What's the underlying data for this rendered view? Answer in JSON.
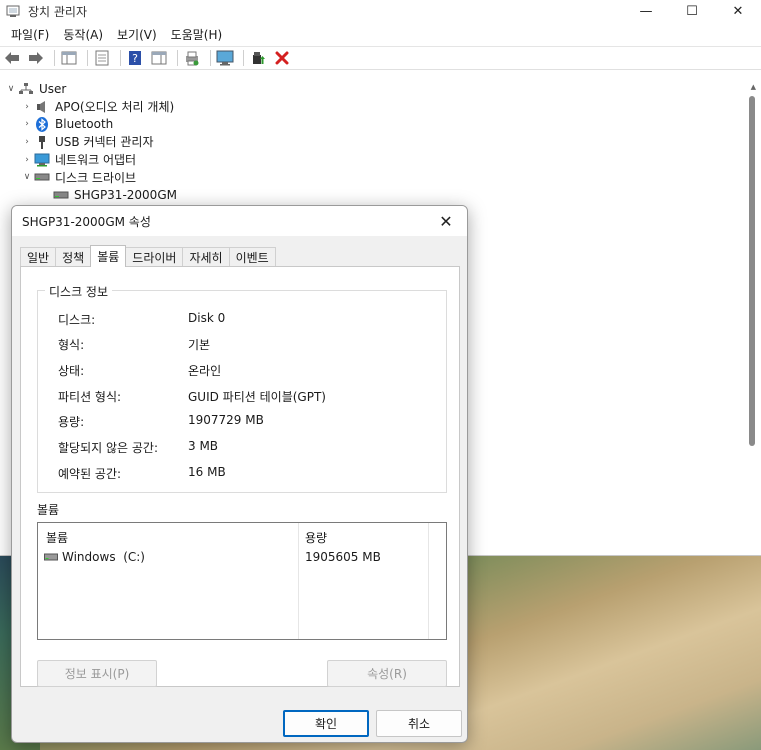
{
  "device_manager": {
    "title": "장치 관리자",
    "window_controls": {
      "minimize": "—",
      "maximize": "☐",
      "close": "✕"
    },
    "menu": [
      "파일(F)",
      "동작(A)",
      "보기(V)",
      "도움말(H)"
    ],
    "tree": {
      "root": "User",
      "items": [
        {
          "label": "APO(오디오 처리 개체)",
          "icon": "speaker-icon"
        },
        {
          "label": "Bluetooth",
          "icon": "bluetooth-icon"
        },
        {
          "label": "USB 커넥터 관리자",
          "icon": "usb-icon"
        },
        {
          "label": "네트워크 어댑터",
          "icon": "monitor-network-icon"
        },
        {
          "label": "디스크 드라이브",
          "icon": "disk-drive-icon",
          "expanded": true
        }
      ],
      "child": "SHGP31-2000GM"
    }
  },
  "dialog": {
    "title": "SHGP31-2000GM 속성",
    "tabs": [
      "일반",
      "정책",
      "볼륨",
      "드라이버",
      "자세히",
      "이벤트"
    ],
    "active_tab": "볼륨",
    "disk_info": {
      "legend": "디스크 정보",
      "rows": [
        {
          "label": "디스크:",
          "value": "Disk 0"
        },
        {
          "label": "형식:",
          "value": "기본"
        },
        {
          "label": "상태:",
          "value": "온라인"
        },
        {
          "label": "파티션 형식:",
          "value": "GUID 파티션 테이블(GPT)"
        },
        {
          "label": "용량:",
          "value": "1907729 MB"
        },
        {
          "label": "할당되지 않은 공간:",
          "value": "3 MB"
        },
        {
          "label": "예약된 공간:",
          "value": "16 MB"
        }
      ]
    },
    "volumes": {
      "legend": "볼륨",
      "headers": [
        "볼륨",
        "용량"
      ],
      "rows": [
        {
          "name": "Windows  (C:)",
          "size": "1905605 MB"
        }
      ]
    },
    "buttons": {
      "show_info": "정보 표시(P)",
      "properties": "속성(R)",
      "ok": "확인",
      "cancel": "취소"
    }
  }
}
